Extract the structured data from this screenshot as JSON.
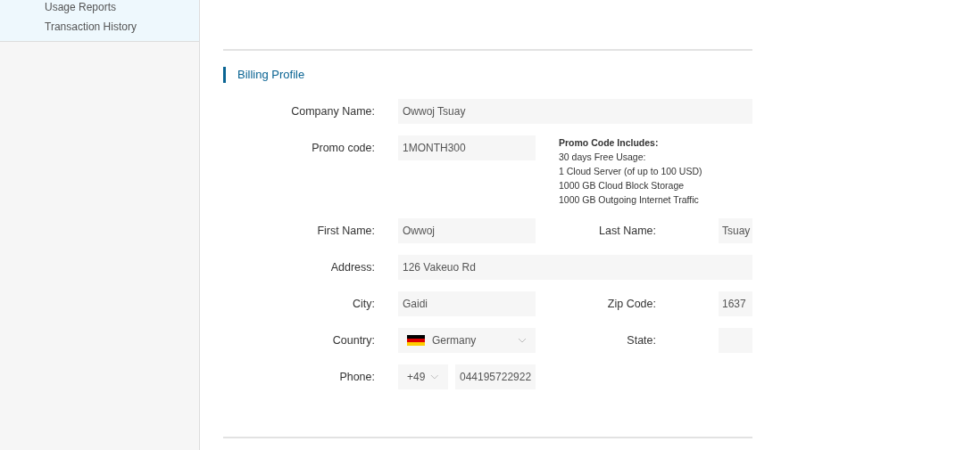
{
  "sidebar": {
    "items": [
      {
        "label": "Usage Reports",
        "selected": false
      },
      {
        "label": "Transaction History",
        "selected": false
      }
    ]
  },
  "billing_profile": {
    "title": "Billing Profile",
    "company_name": {
      "label": "Company Name:",
      "value": "Owwoj Tsuay"
    },
    "promo_code": {
      "label": "Promo code:",
      "value": "1MONTH300"
    },
    "promo_info": {
      "title": "Promo Code Includes:",
      "lines": [
        "30 days Free Usage:",
        "1 Cloud Server (of up to 100 USD)",
        "1000 GB Cloud Block Storage",
        "1000 GB Outgoing Internet Traffic"
      ]
    },
    "first_name": {
      "label": "First Name:",
      "value": "Owwoj"
    },
    "last_name": {
      "label": "Last Name:",
      "value": "Tsuay"
    },
    "address": {
      "label": "Address:",
      "value": "126 Vakeuo Rd"
    },
    "city": {
      "label": "City:",
      "value": "Gaidi"
    },
    "zip_code": {
      "label": "Zip Code:",
      "value": "1637"
    },
    "country": {
      "label": "Country:",
      "value": "Germany"
    },
    "state": {
      "label": "State:"
    },
    "phone": {
      "label": "Phone:",
      "code": "+49",
      "value": "044195722922"
    }
  }
}
